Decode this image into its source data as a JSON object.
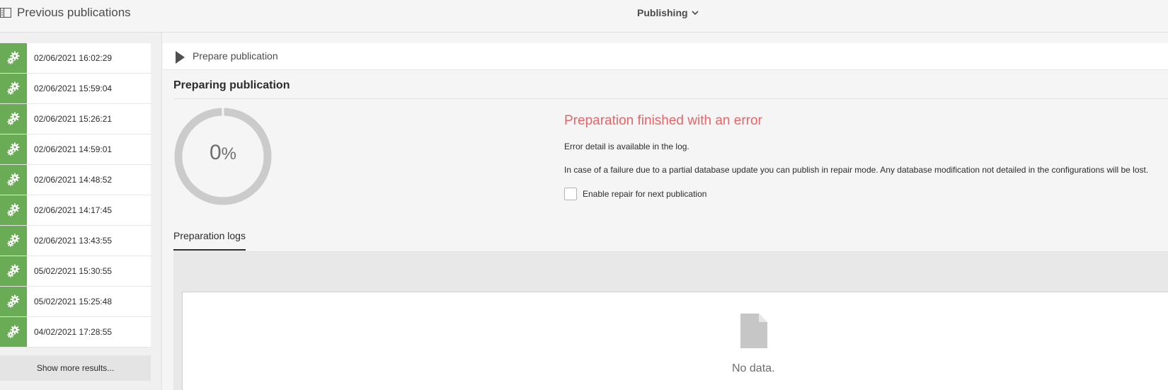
{
  "header": {
    "panel_title": "Previous publications",
    "mode_label": "Publishing"
  },
  "sidebar": {
    "items": [
      {
        "date": "02/06/2021 16:02:29",
        "icon": "gears-icon"
      },
      {
        "date": "02/06/2021 15:59:04",
        "icon": "gears-icon"
      },
      {
        "date": "02/06/2021 15:26:21",
        "icon": "gears-icon"
      },
      {
        "date": "02/06/2021 14:59:01",
        "icon": "gears-icon"
      },
      {
        "date": "02/06/2021 14:48:52",
        "icon": "gears-icon"
      },
      {
        "date": "02/06/2021 14:17:45",
        "icon": "gears-icon"
      },
      {
        "date": "02/06/2021 13:43:55",
        "icon": "gears-icon"
      },
      {
        "date": "05/02/2021 15:30:55",
        "icon": "gears-icon"
      },
      {
        "date": "05/02/2021 15:25:48",
        "icon": "gears-icon"
      },
      {
        "date": "04/02/2021 17:28:55",
        "icon": "gears-icon"
      }
    ],
    "show_more_label": "Show more results...",
    "accent_color": "#6aac55"
  },
  "main": {
    "prepare_label": "Prepare publication",
    "section_title": "Preparing publication",
    "progress": {
      "number": "0",
      "unit": "%",
      "fraction": 0
    },
    "status_title": "Preparation finished with an error",
    "status_color": "#e3676a",
    "error_detail": "Error detail is available in the log.",
    "repair_note": "In case of a failure due to a partial database update you can publish in repair mode. Any database modification not detailed in the configurations will be lost.",
    "repair_checkbox": {
      "label": "Enable repair for next publication",
      "checked": false
    },
    "tabs": [
      {
        "label": "Preparation logs",
        "active": true
      }
    ],
    "logs_empty_text": "No data."
  }
}
